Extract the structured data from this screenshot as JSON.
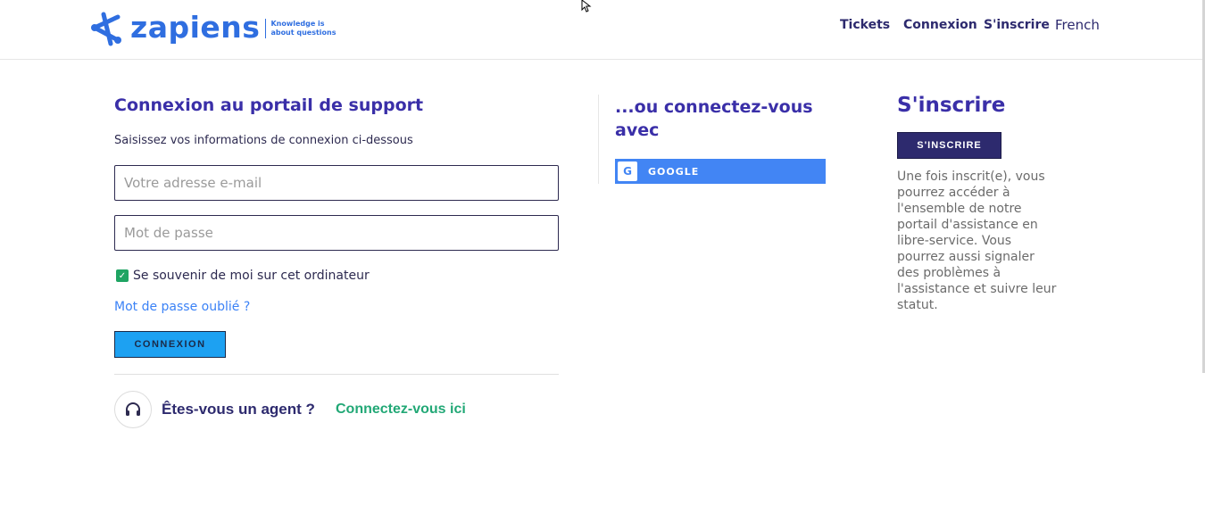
{
  "header": {
    "logo_name": "zapiens",
    "logo_tagline": "Knowledge is about questions",
    "nav": {
      "tickets": "Tickets",
      "connexion": "Connexion",
      "sinscrire": "S'inscrire",
      "language": "French"
    }
  },
  "login": {
    "title": "Connexion au portail de support",
    "subtitle": "Saisissez vos informations de connexion ci-dessous",
    "email_placeholder": "Votre adresse e-mail",
    "email_value": "",
    "password_placeholder": "Mot de passe",
    "password_value": "",
    "remember_label": "Se souvenir de moi sur cet ordinateur",
    "remember_checked": true,
    "forgot_link": "Mot de passe oublié ?",
    "submit_label": "CONNEXION"
  },
  "agent": {
    "question": "Êtes-vous un agent ?",
    "link": "Connectez-vous ici"
  },
  "social": {
    "title": "...ou connectez-vous avec",
    "google_label": "GOOGLE",
    "google_icon": "G"
  },
  "signup": {
    "title": "S'inscrire",
    "button_label": "S'INSCRIRE",
    "description": "Une fois inscrit(e), vous pourrez accéder à l'ensemble de notre portail d'assistance en libre-service. Vous pourrez aussi signaler des problèmes à l'assistance et suivre leur statut."
  },
  "colors": {
    "brand_blue": "#2f6ee0",
    "heading_purple": "#3a2fa8",
    "connexion_button": "#1da1f2",
    "google_button": "#4285f4",
    "signup_button": "#2d2a6e",
    "agent_link": "#22a876",
    "checkbox": "#1fa463"
  }
}
